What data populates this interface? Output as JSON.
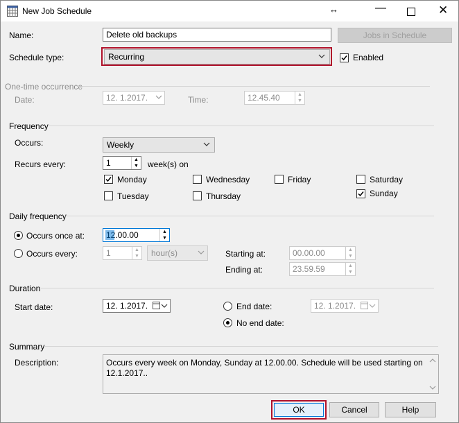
{
  "window": {
    "title": "New Job Schedule"
  },
  "name": {
    "label": "Name:",
    "value": "Delete old backups"
  },
  "jobs_button": "Jobs in Schedule",
  "schedule_type": {
    "label": "Schedule type:",
    "value": "Recurring",
    "enabled_label": "Enabled",
    "enabled_checked": true
  },
  "one_time": {
    "section": "One-time occurrence",
    "date_label": "Date:",
    "date_value": "12.  1.2017.",
    "time_label": "Time:",
    "time_value": "12.45.40"
  },
  "frequency": {
    "section": "Frequency",
    "occurs_label": "Occurs:",
    "occurs_value": "Weekly",
    "recurs_label": "Recurs every:",
    "recurs_value": "1",
    "recurs_unit": "week(s) on",
    "days": [
      {
        "label": "Monday",
        "checked": true
      },
      {
        "label": "Wednesday",
        "checked": false
      },
      {
        "label": "Friday",
        "checked": false
      },
      {
        "label": "Saturday",
        "checked": false
      },
      {
        "label": "Tuesday",
        "checked": false
      },
      {
        "label": "Thursday",
        "checked": false
      },
      {
        "label": "Sunday",
        "checked": true
      }
    ]
  },
  "daily": {
    "section": "Daily frequency",
    "once_label": "Occurs once at:",
    "once_value": "12.00.00",
    "every_label": "Occurs every:",
    "every_value": "1",
    "every_unit": "hour(s)",
    "starting_label": "Starting at:",
    "starting_value": "00.00.00",
    "ending_label": "Ending at:",
    "ending_value": "23.59.59"
  },
  "duration": {
    "section": "Duration",
    "start_label": "Start date:",
    "start_value": "12.  1.2017.",
    "end_label": "End date:",
    "end_value": "12.  1.2017.",
    "no_end_label": "No end date:"
  },
  "summary": {
    "section": "Summary",
    "desc_label": "Description:",
    "desc_value": "Occurs every week on Monday, Sunday at 12.00.00. Schedule will be used starting on 12.1.2017.."
  },
  "buttons": {
    "ok": "OK",
    "cancel": "Cancel",
    "help": "Help"
  },
  "colors": {
    "highlight_border": "#b0112a",
    "selection": "#0078d7",
    "disabled_text": "#8c8c8c"
  }
}
